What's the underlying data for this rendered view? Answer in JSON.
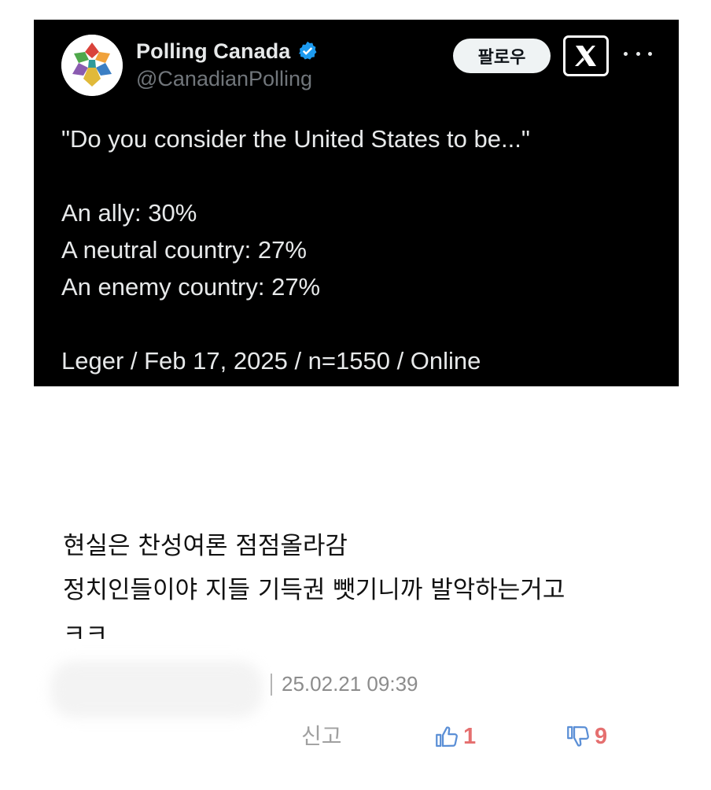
{
  "tweet": {
    "display_name": "Polling Canada",
    "handle": "@CanadianPolling",
    "follow_label": "팔로우",
    "verified_color": "#1d9bf0",
    "lines": [
      "\"Do you consider the United States to be...\"",
      "",
      "An ally: 30%",
      "A neutral country: 27%",
      "An enemy country: 27%",
      "",
      "Leger / Feb 17, 2025 / n=1550 / Online"
    ],
    "icons": [
      "avatar-logo",
      "verified-badge-icon",
      "x-logo-icon",
      "more-icon"
    ]
  },
  "comment": {
    "lines": [
      "현실은 찬성여론 점점올라감",
      "정치인들이야 지들 기득권 뺏기니까 발악하는거고",
      "ㅋㅋ"
    ],
    "timestamp": "25.02.21 09:39",
    "report_label": "신고",
    "like_count": "1",
    "dislike_count": "9",
    "like_icon": "thumbs-up-icon",
    "dislike_icon": "thumbs-down-icon",
    "icon_color": "#5b8fd6",
    "count_color": "#e56f6f"
  }
}
